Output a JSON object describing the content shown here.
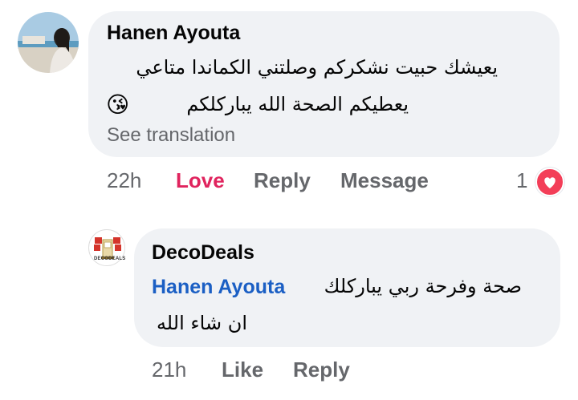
{
  "comment": {
    "author": "Hanen Ayouta",
    "line1": "يعيشك حبيت نشكركم وصلتني الكماندا متاعي",
    "line2": "يعطيكم الصحة الله يباركلكم",
    "emoji": "😘",
    "see_translation": "See translation",
    "time": "22h",
    "love_label": "Love",
    "reply_label": "Reply",
    "message_label": "Message",
    "reaction_count": "1",
    "reaction_icon": "heart-icon"
  },
  "reply": {
    "author": "DecoDeals",
    "mention": "Hanen Ayouta",
    "line1_rest": "صحة وفرحة ربي يباركلك",
    "line2": "ان شاء الله",
    "time": "21h",
    "like_label": "Like",
    "reply_label": "Reply",
    "logo_text": "DECODEALS"
  },
  "colors": {
    "bubble": "#f0f2f5",
    "love": "#e0245e",
    "mention": "#1b5fc4",
    "muted": "#65676b",
    "heart": "#f33e58"
  }
}
